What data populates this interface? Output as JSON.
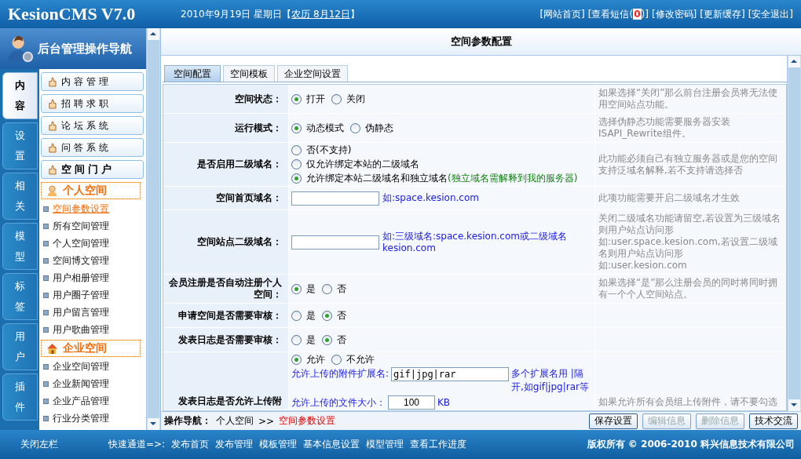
{
  "header": {
    "logo": "KesionCMS V7.0",
    "date": "2010年9月19日  星期日【",
    "lunar": "农历 8月12日",
    "date_end": "】",
    "links": [
      {
        "text": "[网站首页]"
      },
      {
        "text": "[查看短信(",
        "count": "0",
        "after": ")]"
      },
      {
        "text": "[修改密码]"
      },
      {
        "text": "[更新缓存]"
      },
      {
        "text": "[安全退出]"
      }
    ]
  },
  "sidebar": {
    "title": "后台管理操作导航",
    "tabs": [
      {
        "label": "内容",
        "selected": true
      },
      {
        "label": "设置",
        "selected": false
      },
      {
        "label": "相关",
        "selected": false
      },
      {
        "label": "模型",
        "selected": false
      },
      {
        "label": "标签",
        "selected": false
      },
      {
        "label": "用户",
        "selected": false
      },
      {
        "label": "插件",
        "selected": false
      }
    ],
    "menus": [
      {
        "label": "内容管理",
        "selected": false
      },
      {
        "label": "招聘求职",
        "selected": false
      },
      {
        "label": "论坛系统",
        "selected": false
      },
      {
        "label": "问答系统",
        "selected": false
      },
      {
        "label": "空间门户",
        "selected": true
      }
    ],
    "sections": [
      {
        "title": "个人空间",
        "kind": "person",
        "items": [
          {
            "label": "空间参数设置",
            "selected": true
          },
          {
            "label": "所有空间管理",
            "selected": false
          },
          {
            "label": "个人空间管理",
            "selected": false
          },
          {
            "label": "空间博文管理",
            "selected": false
          },
          {
            "label": "用户相册管理",
            "selected": false
          },
          {
            "label": "用户圈子管理",
            "selected": false
          },
          {
            "label": "用户留言管理",
            "selected": false
          },
          {
            "label": "用户歌曲管理",
            "selected": false
          }
        ]
      },
      {
        "title": "企业空间",
        "kind": "house",
        "items": [
          {
            "label": "企业空间管理",
            "selected": false
          },
          {
            "label": "企业新闻管理",
            "selected": false
          },
          {
            "label": "企业产品管理",
            "selected": false
          },
          {
            "label": "行业分类管理",
            "selected": false
          }
        ]
      }
    ]
  },
  "main": {
    "title": "空间参数配置",
    "tabs": [
      {
        "label": "空间配置",
        "selected": true
      },
      {
        "label": "空间模板",
        "selected": false
      },
      {
        "label": "企业空间设置",
        "selected": false
      }
    ],
    "rows": [
      {
        "label": "空间状态：",
        "kind": "radio",
        "options": [
          {
            "label": "打开",
            "selected": true
          },
          {
            "label": "关闭",
            "selected": false
          }
        ],
        "note": [
          "如果选择“关闭”那么前台注册会员将无法使用空间站点功能。"
        ]
      },
      {
        "label": "运行模式：",
        "kind": "radio",
        "options": [
          {
            "label": "动态模式",
            "selected": true
          },
          {
            "label": "伪静态",
            "selected": false
          }
        ],
        "note": [
          "选择伪静态功能需要服务器安装ISAPI_Rewrite组件。"
        ]
      },
      {
        "label": "是否启用二级域名：",
        "kind": "radio_list",
        "options": [
          {
            "label": "否(不支持)",
            "selected": false
          },
          {
            "label": "仅允许绑定本站的二级域名",
            "selected": false
          },
          {
            "label": "允许绑定本站二级域名和独立域名",
            "hint": "(独立域名需解释到我的服务器)",
            "selected": true
          }
        ],
        "note": [
          "此功能必须自己有独立服务器或是您的空间支持泛域名解释,若不支持请选择否"
        ]
      },
      {
        "label": "空间首页域名：",
        "kind": "text",
        "value": "",
        "hint": "如:space.kesion.com",
        "note": [
          "此项功能需要开启二级域名才生效"
        ]
      },
      {
        "label": "空间站点二级域名：",
        "kind": "text",
        "value": "",
        "hint": "如:三级域名:space.kesion.com或二级域名kesion.com",
        "note": [
          "关闭二级域名功能请留空,若设置为三级域名则用户站点访问形",
          "如:user.space.kesion.com,若设置二级域名则用户站点访问形",
          "如:user.kesion.com"
        ]
      },
      {
        "label": "会员注册是否自动注册个人空间：",
        "kind": "radio",
        "options": [
          {
            "label": "是",
            "selected": true
          },
          {
            "label": "否",
            "selected": false
          }
        ],
        "note": [
          "如果选择“是”那么注册会员的同时将同时拥有一个个人空间站点。"
        ]
      },
      {
        "label": "申请空间是否需要审核：",
        "kind": "radio",
        "options": [
          {
            "label": "是",
            "selected": false
          },
          {
            "label": "否",
            "selected": true
          }
        ]
      },
      {
        "label": "发表日志是否需要审核：",
        "kind": "radio",
        "options": [
          {
            "label": "是",
            "selected": false
          },
          {
            "label": "否",
            "selected": true
          }
        ]
      },
      {
        "label": "发表日志是否允许上传附",
        "kind": "upload",
        "options": [
          {
            "label": "允许",
            "selected": true
          },
          {
            "label": "不允许",
            "selected": false
          }
        ],
        "ext_label": "允许上传的附件扩展名:",
        "ext_value": "gif|jpg|rar",
        "ext_hint": "多个扩展名用 |隔开,如gif|jpg|rar等",
        "size_label": "允许上传的文件大小：",
        "size_value": "100",
        "size_unit": "KB",
        "note": [
          "如果允许所有会员组上传附件，请不要勾选"
        ]
      }
    ]
  },
  "bottom_bar": {
    "label": "操作导航：",
    "crumb": "个人空间",
    "separator": ">>",
    "current": "空间参数设置",
    "buttons": [
      {
        "label": "保存设置",
        "disabled": false
      },
      {
        "label": "编辑信息",
        "disabled": true
      },
      {
        "label": "删除信息",
        "disabled": true
      },
      {
        "label": "技术交流",
        "disabled": false
      }
    ]
  },
  "footer": {
    "close": "关闭左栏",
    "quick_label": "快速通道=>:",
    "links": [
      "发布首页",
      "发布管理",
      "模板管理",
      "基本信息设置",
      "模型管理",
      "查看工作进度"
    ],
    "copyright": "版权所有 © 2006-2010 科兴信息技术有限公司"
  }
}
